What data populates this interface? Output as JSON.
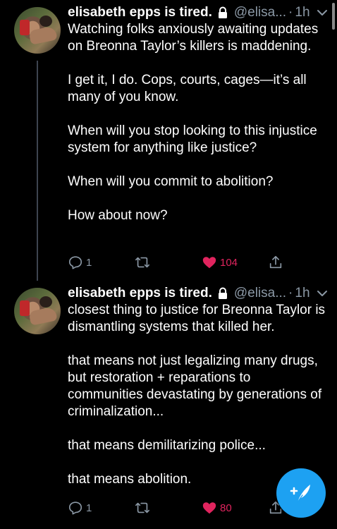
{
  "tweets": [
    {
      "display_name": "elisabeth epps is tired.",
      "handle": "@elisa...",
      "dot": "·",
      "time": "1h",
      "paragraphs": [
        "Watching folks anxiously awaiting updates on Breonna Taylor’s killers is maddening.",
        "I get it, I do. Cops, courts, cages—it’s all many of you know.",
        "When will you stop looking to this injustice system for anything like justice?",
        "When will you commit to abolition?",
        "How about now?"
      ],
      "replies": "1",
      "retweets": "",
      "likes": "104",
      "liked": true
    },
    {
      "display_name": "elisabeth epps is tired.",
      "handle": "@elisa...",
      "dot": "·",
      "time": "1h",
      "paragraphs": [
        "closest thing to justice for Breonna Taylor is dismantling systems that killed her.",
        "that means not just legalizing many drugs, but restoration + reparations to communities devastating by generations of criminalization...",
        "that means demilitarizing police...",
        "that means abolition."
      ],
      "replies": "1",
      "retweets": "",
      "likes": "80",
      "liked": true
    }
  ],
  "colors": {
    "background": "#000000",
    "text": "#ffffff",
    "secondary_text": "#8b98a5",
    "like": "#e0245e",
    "accent": "#1da1f2",
    "thread_line": "#3d4450"
  },
  "icons": {
    "lock": "lock-icon",
    "more": "chevron-down-icon",
    "reply": "reply-icon",
    "retweet": "retweet-icon",
    "like": "heart-icon",
    "share": "share-icon",
    "compose": "compose-tweet-icon"
  }
}
